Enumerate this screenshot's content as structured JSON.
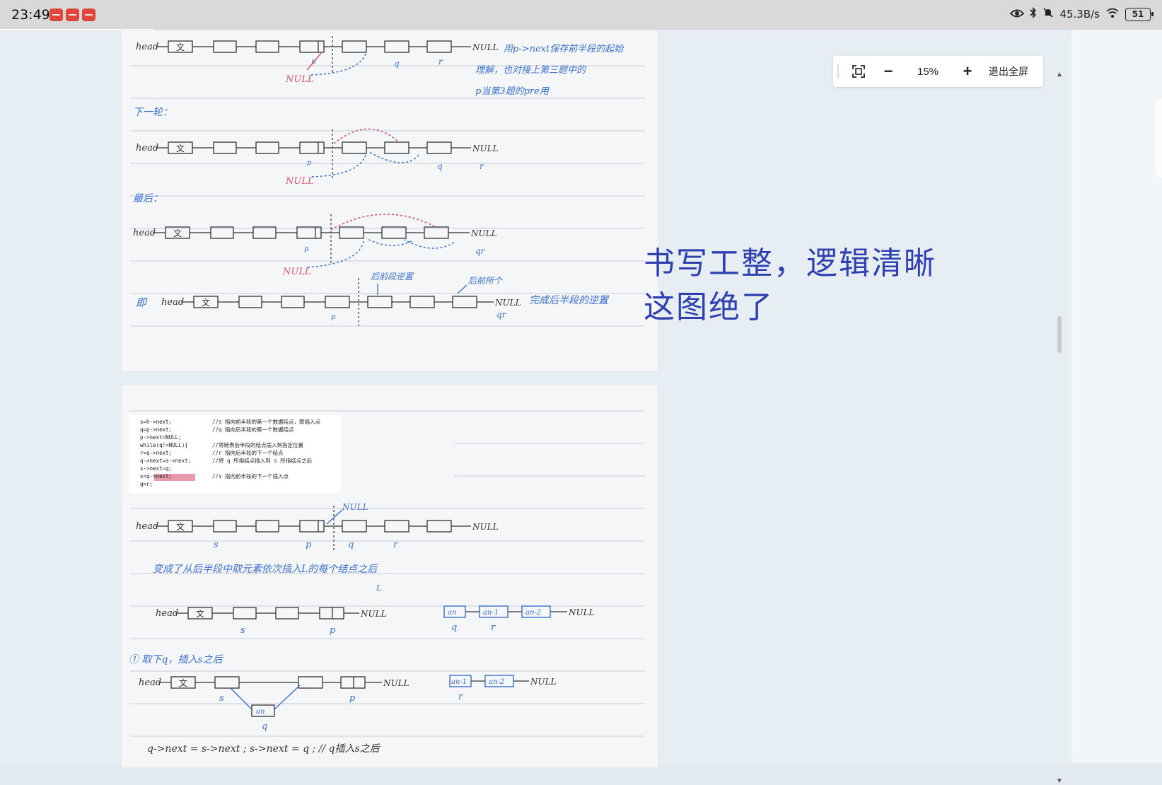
{
  "status_bar": {
    "time": "23:49",
    "network_speed": "45.3B/s",
    "battery_level": "51",
    "icons": [
      "eye-icon",
      "bluetooth-icon",
      "mute-icon",
      "wifi-icon",
      "battery-icon"
    ]
  },
  "toolbar": {
    "zoom": "15%",
    "zoom_out_label": "−",
    "zoom_in_label": "+",
    "exit_fullscreen_label": "退出全屏"
  },
  "caption": {
    "line1": "书写工整，逻辑清晰",
    "line2": "这图绝了"
  },
  "notes_page1": {
    "head": "head",
    "node0": "文",
    "null": "NULL",
    "null_red": "NULL",
    "p": "p",
    "q": "q",
    "r": "r",
    "qr": "qr",
    "note_line1": "用p->next保存前半段的起始",
    "note_line2": "理解，也对接上第三题中的",
    "note_line3": "p当第3题的pre用",
    "next_round": "下一轮：",
    "finally": "最后：",
    "ji": "即",
    "front_label": "后前段逆置",
    "back_label": "后前所个",
    "done_note": "完成后半段的逆置"
  },
  "notes_page2": {
    "code_lines": [
      {
        "code": "s=h->next;",
        "comment": "//s 指向前半段的第一个数据结点，即插入点"
      },
      {
        "code": "q=p->next;",
        "comment": "//q 指向后半段的第一个数据结点"
      },
      {
        "code": "p->next=NULL;",
        "comment": ""
      },
      {
        "code": "while(q!=NULL){",
        "comment": "//将链表后半段的结点插入到指定位置"
      },
      {
        "code": "  r=q->next;",
        "comment": "//r 指向后半段的下一个结点"
      },
      {
        "code": "  q->next=s->next;",
        "comment": "//将 q 所指结点插入到 s 所指结点之后"
      },
      {
        "code": "  s->next=q;",
        "comment": ""
      },
      {
        "code": "  s=q->next;",
        "comment": "//s 指向前半段的下一个插入点"
      },
      {
        "code": "  q=r;",
        "comment": ""
      }
    ],
    "null": "NULL",
    "s": "s",
    "p": "p",
    "q": "q",
    "r": "r",
    "L": "L",
    "sentence": "变成了从后半段中取元素依次插入L的每个结点之后",
    "an": "an",
    "an1": "an-1",
    "an2": "an-2",
    "step1": "① 取下q，插入s之后",
    "bottom_code": "q->next = s->next ;  s->next = q ;  // q插入s之后"
  }
}
